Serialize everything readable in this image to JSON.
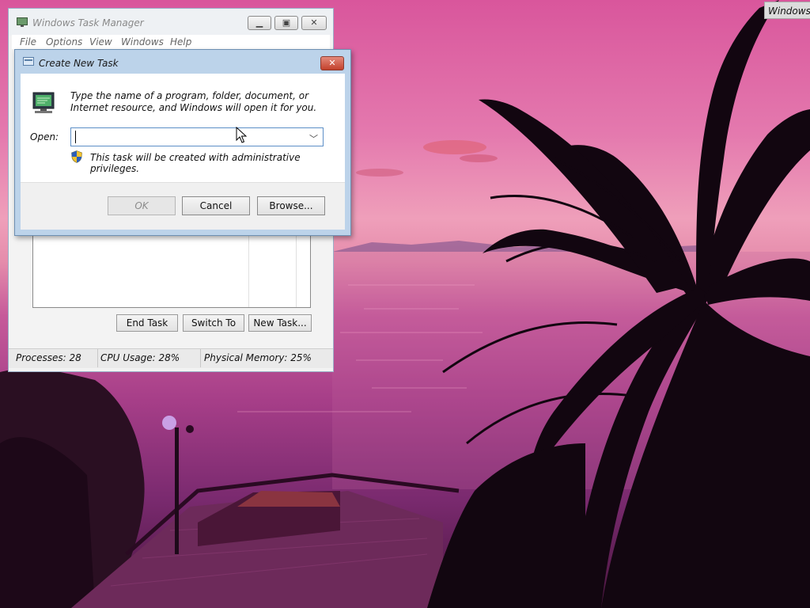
{
  "desktop": {
    "workspace_label": "Windows S"
  },
  "task_manager": {
    "title": "Windows Task Manager",
    "menu": [
      "File",
      "Options",
      "View",
      "Windows",
      "Help"
    ],
    "buttons": {
      "end_task": "End Task",
      "switch_to": "Switch To",
      "new_task": "New Task..."
    },
    "status": {
      "processes": "Processes: 28",
      "cpu_usage": "CPU Usage: 28%",
      "physical_memory": "Physical Memory: 25%"
    }
  },
  "dialog": {
    "title": "Create New Task",
    "instruction": "Type the name of a program, folder, document, or Internet resource, and Windows will open it for you.",
    "open_label": "Open:",
    "open_value": "",
    "admin_note": "This task will be created with administrative privileges.",
    "buttons": {
      "ok": "OK",
      "cancel": "Cancel",
      "browse": "Browse..."
    }
  },
  "icons": {
    "task_manager_app": "monitor-icon",
    "dialog_app": "run-icon",
    "program": "computer-icon",
    "shield": "uac-shield-icon",
    "close": "close-icon",
    "minimize": "minimize-icon",
    "maximize": "maximize-icon",
    "dropdown": "chevron-down-icon",
    "cursor": "mouse-cursor-icon"
  },
  "colors": {
    "dialog_frame": "#bcd3ea",
    "close_button": "#c2412c",
    "combo_border": "#5d8fc7"
  }
}
